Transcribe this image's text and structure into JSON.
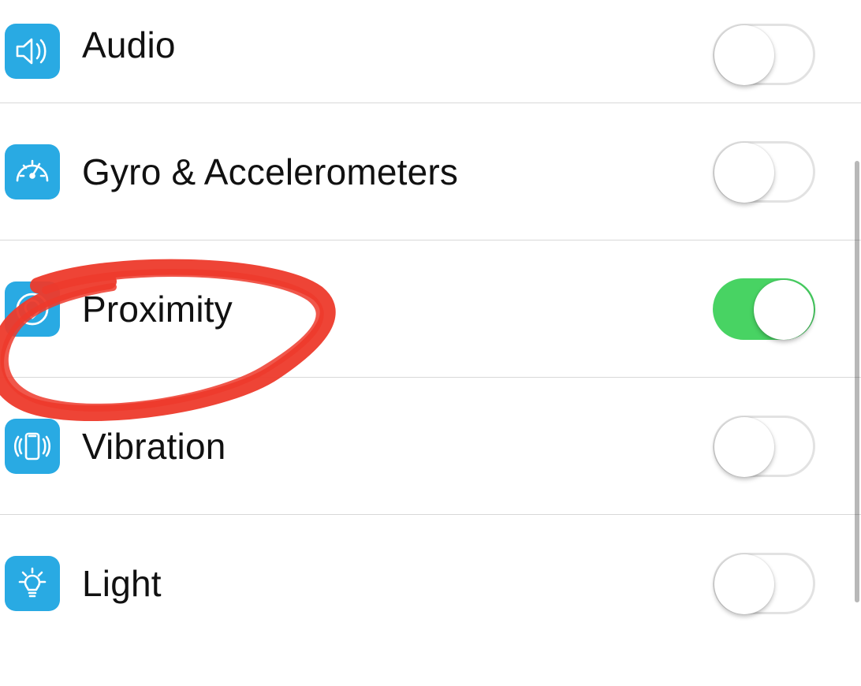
{
  "settings": {
    "items": [
      {
        "key": "audio",
        "label": "Audio",
        "icon": "speaker-icon",
        "enabled": false
      },
      {
        "key": "gyro",
        "label": "Gyro & Accelerometers",
        "icon": "gauge-icon",
        "enabled": false
      },
      {
        "key": "proximity",
        "label": "Proximity",
        "icon": "pin-icon",
        "enabled": true
      },
      {
        "key": "vibration",
        "label": "Vibration",
        "icon": "vibration-icon",
        "enabled": false
      },
      {
        "key": "light",
        "label": "Light",
        "icon": "lightbulb-icon",
        "enabled": false
      }
    ]
  },
  "annotation": {
    "highlighted_item": "proximity",
    "color": "#ed3a2b"
  }
}
